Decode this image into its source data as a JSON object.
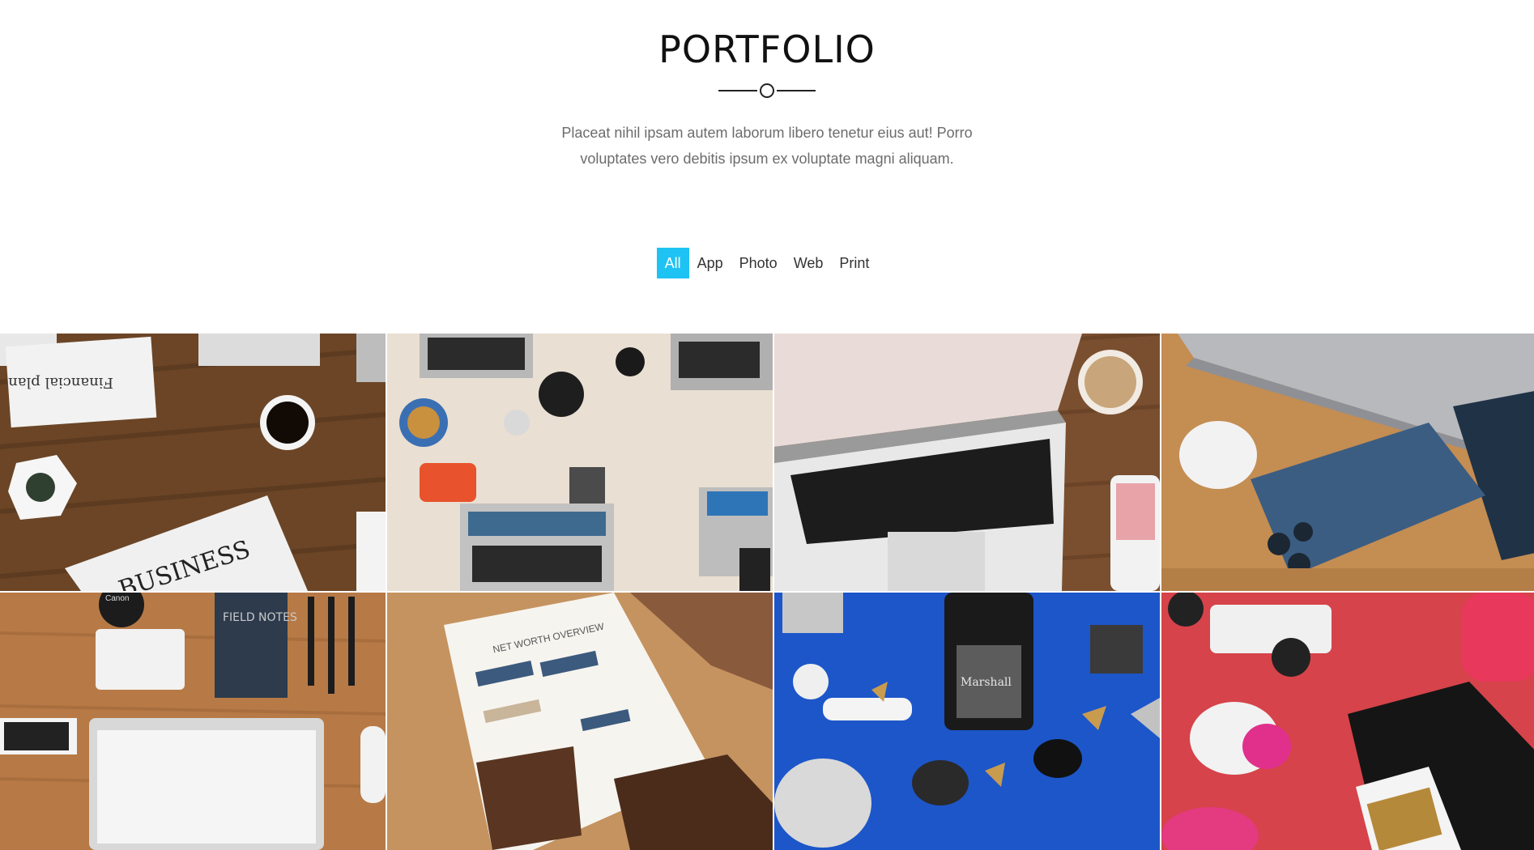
{
  "portfolio": {
    "title": "PORTFOLIO",
    "description": "Placeat nihil ipsam autem laborum libero tenetur eius aut! Porro voluptates vero debitis ipsum ex voluptate magni aliquam."
  },
  "filters": [
    {
      "label": "All",
      "active": true
    },
    {
      "label": "App",
      "active": false
    },
    {
      "label": "Photo",
      "active": false
    },
    {
      "label": "Web",
      "active": false
    },
    {
      "label": "Print",
      "active": false
    }
  ],
  "items": [
    {
      "photo_text": [
        "Financial plan",
        "BUSINESS"
      ]
    },
    {
      "photo_text": []
    },
    {
      "photo_text": []
    },
    {
      "photo_text": []
    },
    {
      "photo_text": [
        "FIELD NOTES",
        "Canon"
      ]
    },
    {
      "photo_text": [
        "NET WORTH OVERVIEW"
      ]
    },
    {
      "photo_text": [
        "Marshall"
      ]
    },
    {
      "photo_text": []
    }
  ],
  "colors": {
    "accent": "#1ec3f3",
    "text": "#111111",
    "muted": "#6c6c6c"
  }
}
